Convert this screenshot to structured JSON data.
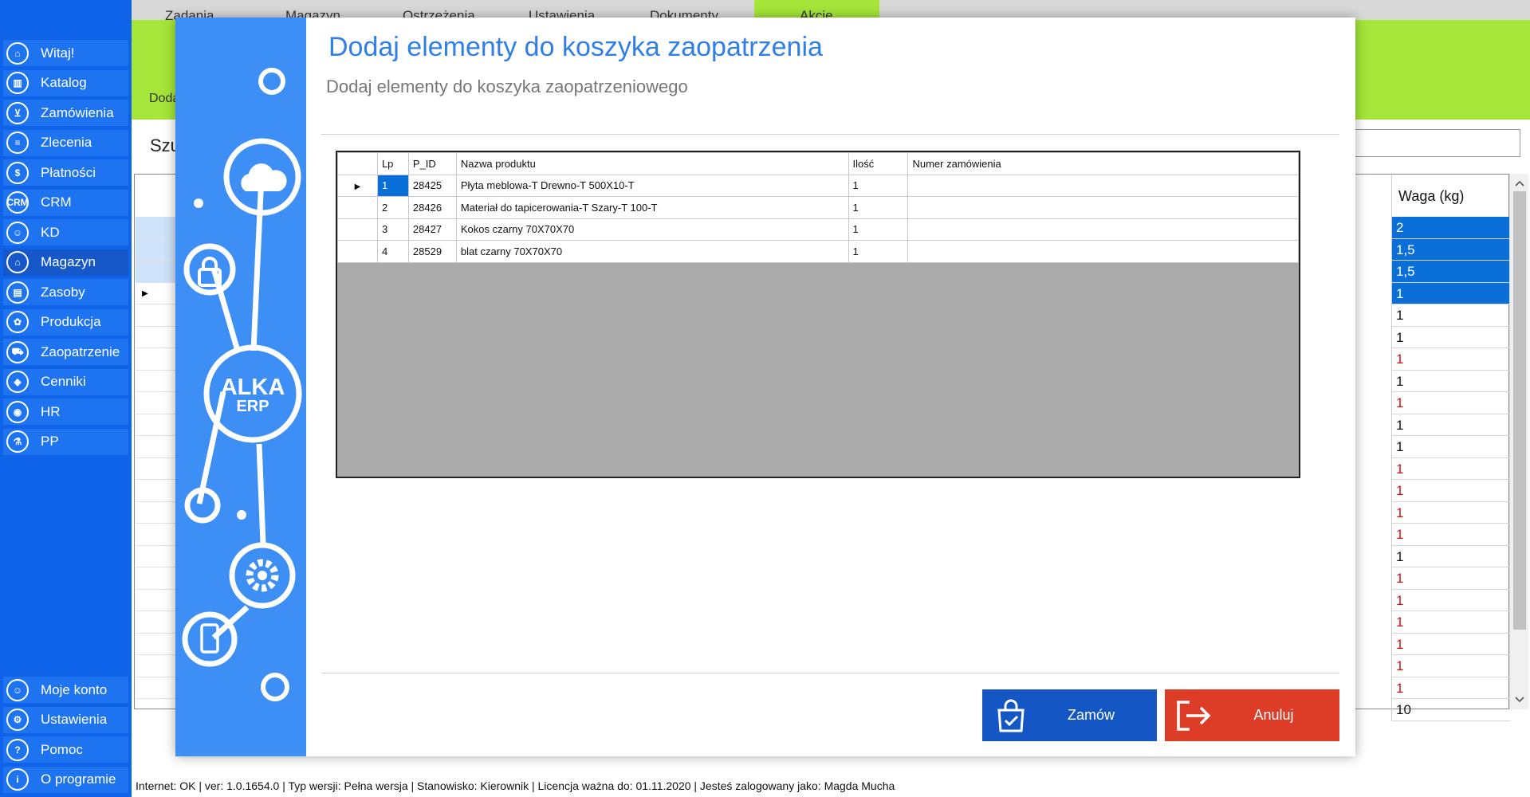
{
  "sidebar": {
    "items": [
      {
        "label": "Witaj!",
        "icon": "home-icon",
        "glyph": "⌂"
      },
      {
        "label": "Katalog",
        "icon": "book-icon",
        "glyph": "▥"
      },
      {
        "label": "Zamówienia",
        "icon": "cart-icon",
        "glyph": "⊻"
      },
      {
        "label": "Zlecenia",
        "icon": "list-icon",
        "glyph": "≡"
      },
      {
        "label": "Płatności",
        "icon": "dollar-icon",
        "glyph": "$"
      },
      {
        "label": "CRM",
        "icon": "crm-icon",
        "glyph": "CRM"
      },
      {
        "label": "KD",
        "icon": "user-icon",
        "glyph": "☺"
      },
      {
        "label": "Magazyn",
        "icon": "warehouse-icon",
        "glyph": "⌂"
      },
      {
        "label": "Zasoby",
        "icon": "resources-icon",
        "glyph": "▤"
      },
      {
        "label": "Produkcja",
        "icon": "production-icon",
        "glyph": "✿"
      },
      {
        "label": "Zaopatrzenie",
        "icon": "truck-icon",
        "glyph": "⛟"
      },
      {
        "label": "Cenniki",
        "icon": "tag-icon",
        "glyph": "◈"
      },
      {
        "label": "HR",
        "icon": "hr-icon",
        "glyph": "◉"
      },
      {
        "label": "PP",
        "icon": "pp-icon",
        "glyph": "⚗"
      }
    ],
    "bottom_items": [
      {
        "label": "Moje konto",
        "icon": "account-icon",
        "glyph": "☺"
      },
      {
        "label": "Ustawienia",
        "icon": "settings-icon",
        "glyph": "⚙"
      },
      {
        "label": "Pomoc",
        "icon": "help-icon",
        "glyph": "?"
      },
      {
        "label": "O programie",
        "icon": "info-icon",
        "glyph": "i"
      }
    ]
  },
  "background": {
    "tabs": [
      "Zadania",
      "Magazyn",
      "Ostrzeżenia",
      "Ustawienia",
      "Dokumenty",
      "Akcje"
    ],
    "breadcrumb": "Doda",
    "search_label": "Szu",
    "waga_header": "Waga (kg)",
    "waga_values": [
      "2",
      "1,5",
      "1,5",
      "1",
      "1",
      "1",
      "1",
      "1",
      "1",
      "1",
      "1",
      "1",
      "1",
      "1",
      "1",
      "1",
      "1",
      "1",
      "1",
      "1",
      "1",
      "1",
      "10"
    ],
    "waga_colors": [
      "sel",
      "sel",
      "sel",
      "sel",
      "",
      "",
      "red",
      "",
      "red",
      "",
      "",
      "red",
      "red",
      "red",
      "red",
      "",
      "red",
      "red",
      "red",
      "red",
      "red",
      "red",
      ""
    ]
  },
  "statusbar": {
    "text": "Internet: OK  |   ver: 1.0.1654.0   |   Typ wersji: Pełna wersja   |   Stanowisko: Kierownik   |   Licencja ważna do: 01.11.2020   |   Jesteś zalogowany jako: Magda Mucha"
  },
  "modal": {
    "title": "Dodaj elementy do koszyka zaopatrzenia",
    "subtitle": "Dodaj elementy do koszyka zaopatrzeniowego",
    "logo_text": "ALKA",
    "logo_subtext": "ERP",
    "columns": [
      "Lp",
      "P_ID",
      "Nazwa produktu",
      "Ilość",
      "Numer zamówienia"
    ],
    "rows": [
      {
        "lp": "1",
        "pid": "28425",
        "name": "Płyta meblowa-T Drewno-T 500X10-T",
        "qty": "1",
        "order": ""
      },
      {
        "lp": "2",
        "pid": "28426",
        "name": "Materiał do tapicerowania-T Szary-T 100-T",
        "qty": "1",
        "order": ""
      },
      {
        "lp": "3",
        "pid": "28427",
        "name": "Kokos czarny 70X70X70",
        "qty": "1",
        "order": ""
      },
      {
        "lp": "4",
        "pid": "28529",
        "name": "blat czarny 70X70X70",
        "qty": "1",
        "order": ""
      }
    ],
    "order_button": "Zamów",
    "cancel_button": "Anuluj"
  },
  "colors": {
    "sidebar": "#0f63e8",
    "accent_green": "#a6e63a",
    "modal_panel": "#3d8ef5",
    "title_blue": "#2f7fe6",
    "order_button": "#1457c4",
    "cancel_button": "#dd3c27",
    "selection": "#0a6fd8"
  }
}
